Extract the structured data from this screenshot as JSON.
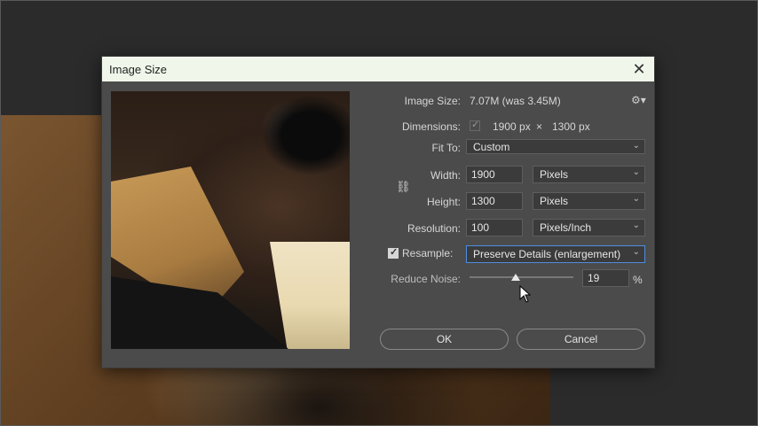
{
  "dialog": {
    "title": "Image Size",
    "image_size": {
      "label": "Image Size:",
      "value": "7.07M (was 3.45M)"
    },
    "dimensions": {
      "label": "Dimensions:",
      "width_value": "1900 px",
      "times": "×",
      "height_value": "1300 px"
    },
    "fit_to": {
      "label": "Fit To:",
      "selected": "Custom"
    },
    "width": {
      "label": "Width:",
      "value": "1900",
      "unit": "Pixels"
    },
    "height": {
      "label": "Height:",
      "value": "1300",
      "unit": "Pixels"
    },
    "resolution": {
      "label": "Resolution:",
      "value": "100",
      "unit": "Pixels/Inch"
    },
    "resample": {
      "label": "Resample:",
      "checked": true,
      "selected": "Preserve Details (enlargement)"
    },
    "reduce_noise": {
      "label": "Reduce Noise:",
      "value": "19",
      "unit": "%",
      "slider_percent": 19
    },
    "buttons": {
      "ok": "OK",
      "cancel": "Cancel"
    },
    "icons": {
      "close": "close-icon",
      "gear": "gear-icon",
      "link": "link-icon",
      "chevron": "chevron-down-icon"
    }
  }
}
